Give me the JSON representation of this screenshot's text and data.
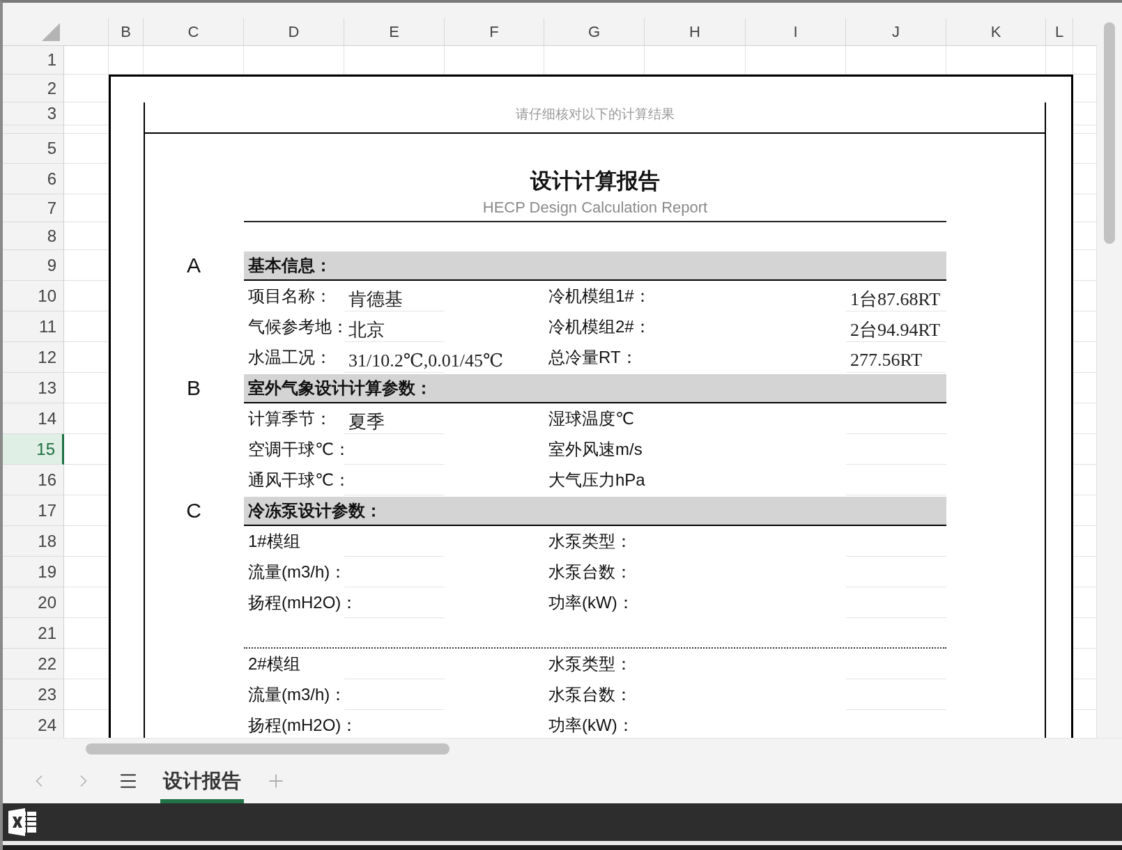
{
  "column_headers": [
    "B",
    "C",
    "D",
    "E",
    "F",
    "G",
    "H",
    "I",
    "J",
    "K",
    "L"
  ],
  "row_numbers": [
    {
      "label": "1",
      "selected": false
    },
    {
      "label": "2",
      "selected": false
    },
    {
      "label": "3",
      "selected": false
    },
    {
      "selected": false
    },
    {
      "label": "5",
      "selected": false
    },
    {
      "label": "6",
      "selected": false
    },
    {
      "label": "7",
      "selected": false
    },
    {
      "label": "8",
      "selected": false
    },
    {
      "label": "9",
      "selected": false
    },
    {
      "label": "10",
      "selected": false
    },
    {
      "label": "11",
      "selected": false
    },
    {
      "label": "12",
      "selected": false
    },
    {
      "label": "13",
      "selected": false
    },
    {
      "label": "14",
      "selected": false
    },
    {
      "label": "15",
      "selected": true
    },
    {
      "label": "16",
      "selected": false
    },
    {
      "label": "17",
      "selected": false
    },
    {
      "label": "18",
      "selected": false
    },
    {
      "label": "19",
      "selected": false
    },
    {
      "label": "20",
      "selected": false
    },
    {
      "label": "21",
      "selected": false
    },
    {
      "label": "22",
      "selected": false
    },
    {
      "label": "23",
      "selected": false
    },
    {
      "label": "24",
      "selected": false
    }
  ],
  "report": {
    "note": "请仔细核对以下的计算结果",
    "title": "设计计算报告",
    "subtitle": "HECP Design Calculation Report",
    "sections": [
      {
        "letter": "A",
        "heading": "基本信息：",
        "rows": [
          {
            "kind": "field",
            "label": "项目名称：",
            "value": "肯德基",
            "label_2": "冷机模组1#：",
            "value_2": "1台87.68RT"
          },
          {
            "kind": "field",
            "label": "气候参考地：",
            "value": "北京",
            "label_2": "冷机模组2#：",
            "value_2": "2台94.94RT"
          },
          {
            "kind": "field",
            "label": "水温工况：",
            "value": "31/10.2℃,0.01/45℃",
            "label_2": "总冷量RT：",
            "value_2": "277.56RT"
          }
        ]
      },
      {
        "letter": "B",
        "heading": "室外气象设计计算参数：",
        "rows": [
          {
            "kind": "field",
            "label": "计算季节：",
            "value": "夏季",
            "label_2": "湿球温度℃"
          },
          {
            "kind": "field",
            "label": "空调干球℃：",
            "label_2": "室外风速m/s"
          },
          {
            "kind": "field",
            "label": "通风干球℃：",
            "label_2": "大气压力hPa"
          }
        ]
      },
      {
        "letter": "C",
        "heading": "冷冻泵设计参数：",
        "rows": [
          {
            "kind": "field",
            "label": "1#模组",
            "label_2": "水泵类型："
          },
          {
            "kind": "field",
            "label": "流量(m3/h)：",
            "label_2": "水泵台数："
          },
          {
            "kind": "field",
            "label": "扬程(mH2O)：",
            "label_2": "功率(kW)："
          },
          {
            "kind": "divider"
          },
          {
            "kind": "field",
            "label": "2#模组",
            "label_2": "水泵类型："
          },
          {
            "kind": "field",
            "label": "流量(m3/h)：",
            "label_2": "水泵台数："
          },
          {
            "kind": "field",
            "label": "扬程(mH2O)：",
            "label_2": "功率(kW)："
          }
        ]
      }
    ]
  },
  "sheet_tabs": [
    {
      "label": "设计报告",
      "selected": true
    }
  ]
}
